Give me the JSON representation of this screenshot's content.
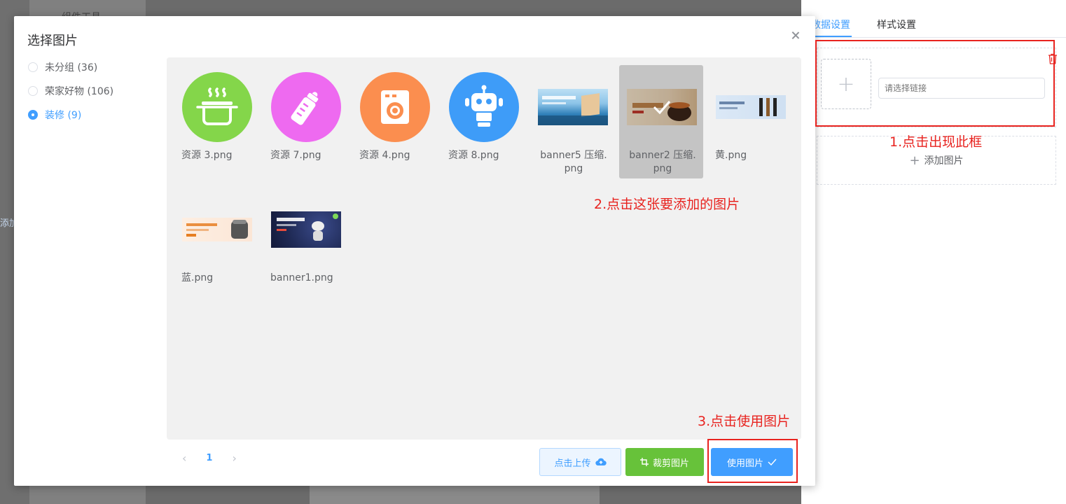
{
  "background": {
    "left_title": "组件工具",
    "add_stub": "添加",
    "tabs": [
      {
        "label": "数据设置",
        "active": true
      },
      {
        "label": "样式设置",
        "active": false
      }
    ],
    "link_placeholder": "请选择链接",
    "add_image_label": "添加图片"
  },
  "modal": {
    "title": "选择图片",
    "groups": [
      {
        "label": "未分组 (36)",
        "active": false
      },
      {
        "label": "荣家好物 (106)",
        "active": false
      },
      {
        "label": "装修 (9)",
        "active": true
      }
    ],
    "images": [
      {
        "name": "资源 3.png",
        "icon": "pot-icon",
        "color": "#84d64a",
        "selected": false
      },
      {
        "name": "资源 7.png",
        "icon": "bottle-icon",
        "color": "#ee6af0",
        "selected": false
      },
      {
        "name": "资源 4.png",
        "icon": "washer-icon",
        "color": "#fb8e4f",
        "selected": false
      },
      {
        "name": "资源 8.png",
        "icon": "robot-icon",
        "color": "#3e9cf8",
        "selected": false
      },
      {
        "name": "banner5 压缩.png",
        "icon": "sea-banner-thumbnail",
        "color": "#2f7fb8",
        "selected": false
      },
      {
        "name": "banner2 压缩.png",
        "icon": "food-banner-thumbnail",
        "color": "#e9d2b4",
        "selected": true
      },
      {
        "name": "黄.png",
        "icon": "product-banner-thumbnail",
        "color": "#cfe0f2",
        "selected": false
      },
      {
        "name": "蓝.png",
        "icon": "cooker-banner-thumbnail",
        "color": "#fbe6d6",
        "selected": false
      },
      {
        "name": "banner1.png",
        "icon": "robot-banner-thumbnail",
        "color": "#1f2a55",
        "selected": false
      }
    ],
    "pagination": {
      "current": "1"
    },
    "buttons": {
      "upload": "点击上传",
      "crop": "裁剪图片",
      "use": "使用图片"
    }
  },
  "annotations": {
    "step1": "1.点击出现此框",
    "step2": "2.点击这张要添加的图片",
    "step3": "3.点击使用图片",
    "color": "#e8231f"
  },
  "colors": {
    "primary": "#409eff",
    "success": "#67c23a"
  }
}
